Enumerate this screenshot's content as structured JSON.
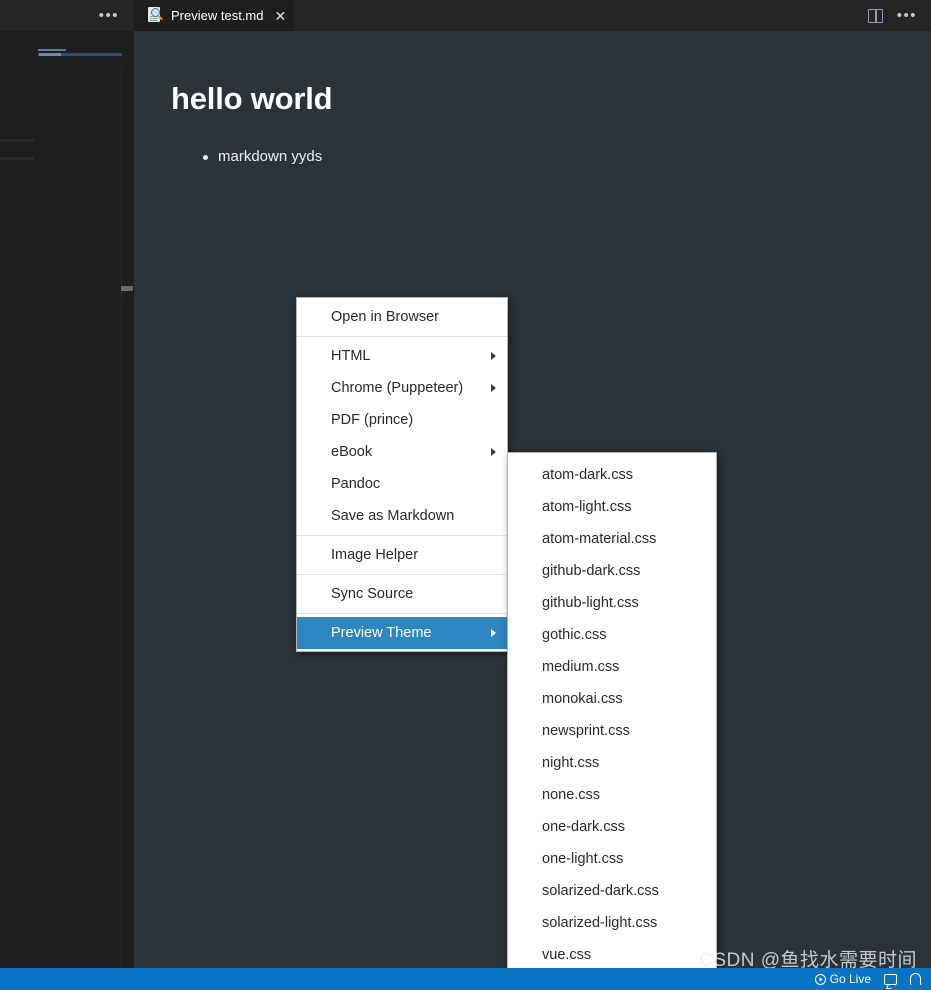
{
  "tabbar": {
    "overflow_dots": "•••",
    "more_dots": "•••",
    "tab": {
      "label": "Preview test.md",
      "close": "✕",
      "icon": "markdown-preview-icon"
    },
    "split_editor_icon": "split-editor-icon"
  },
  "preview": {
    "heading": "hello world",
    "bullets": [
      "markdown yyds"
    ],
    "background_color": "#2b3238",
    "text_color": "#eceff1"
  },
  "context_menu": {
    "accent_color": "#2e86c1",
    "groups": [
      {
        "items": [
          {
            "label": "Open in Browser",
            "submenu": false,
            "selected": false
          }
        ]
      },
      {
        "items": [
          {
            "label": "HTML",
            "submenu": true,
            "selected": false
          },
          {
            "label": "Chrome (Puppeteer)",
            "submenu": true,
            "selected": false
          },
          {
            "label": "PDF (prince)",
            "submenu": false,
            "selected": false
          },
          {
            "label": "eBook",
            "submenu": true,
            "selected": false
          },
          {
            "label": "Pandoc",
            "submenu": false,
            "selected": false
          },
          {
            "label": "Save as Markdown",
            "submenu": false,
            "selected": false
          }
        ]
      },
      {
        "items": [
          {
            "label": "Image Helper",
            "submenu": false,
            "selected": false
          }
        ]
      },
      {
        "items": [
          {
            "label": "Sync Source",
            "submenu": false,
            "selected": false
          }
        ]
      },
      {
        "items": [
          {
            "label": "Preview Theme",
            "submenu": true,
            "selected": true
          }
        ]
      }
    ]
  },
  "submenu": {
    "parent": "Preview Theme",
    "items": [
      "atom-dark.css",
      "atom-light.css",
      "atom-material.css",
      "github-dark.css",
      "github-light.css",
      "gothic.css",
      "medium.css",
      "monokai.css",
      "newsprint.css",
      "night.css",
      "none.css",
      "one-dark.css",
      "one-light.css",
      "solarized-dark.css",
      "solarized-light.css",
      "vue.css"
    ]
  },
  "statusbar": {
    "background_color": "#0a74c4",
    "go_live_label": "Go Live",
    "go_live_icon": "broadcast-icon",
    "feedback_icon": "feedback-icon",
    "bell_icon": "bell-icon"
  },
  "watermark": {
    "text": "CSDN @鱼找水需要时间"
  }
}
